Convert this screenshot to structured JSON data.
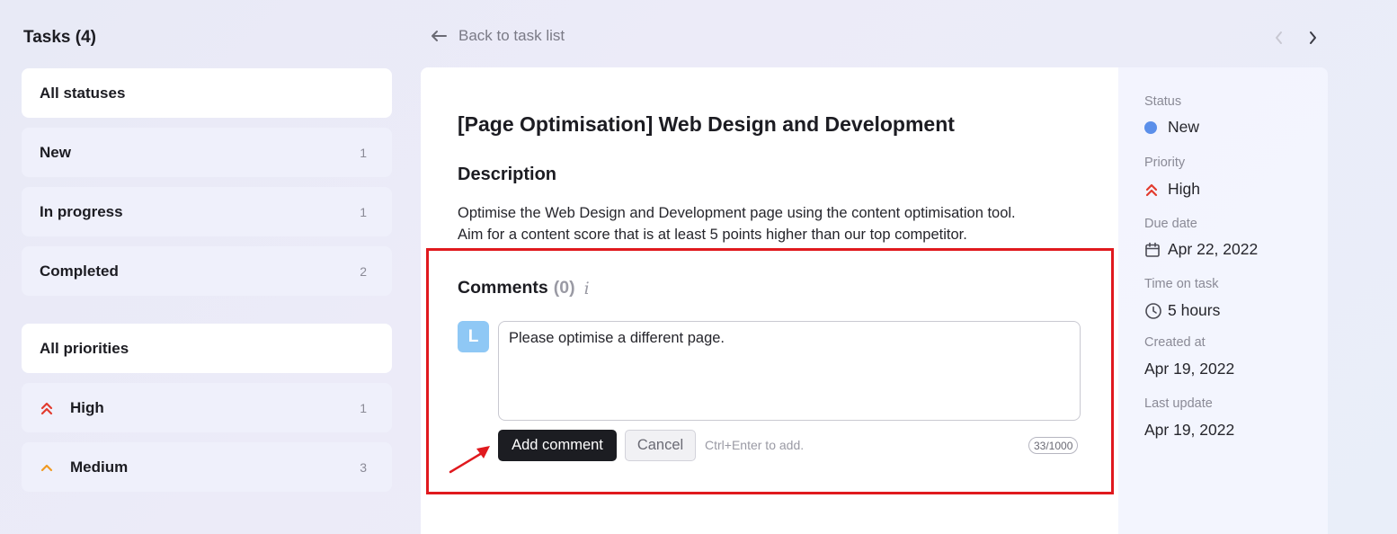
{
  "sidebar": {
    "title": "Tasks (4)",
    "statuses": [
      {
        "label": "All statuses",
        "count": ""
      },
      {
        "label": "New",
        "count": "1"
      },
      {
        "label": "In progress",
        "count": "1"
      },
      {
        "label": "Completed",
        "count": "2"
      }
    ],
    "priorities": [
      {
        "label": "All priorities",
        "count": ""
      },
      {
        "label": "High",
        "count": "1",
        "icon": "double-chevron-up-icon",
        "color": "#e23b2e"
      },
      {
        "label": "Medium",
        "count": "3",
        "icon": "chevron-up-icon",
        "color": "#f09a22"
      }
    ]
  },
  "nav": {
    "back_label": "Back to task list"
  },
  "task": {
    "title": "[Page Optimisation] Web Design and Development",
    "description_heading": "Description",
    "description_lines": [
      "Optimise the Web Design and Development page using the content optimisation tool.",
      "Aim for a content score that is at least 5 points higher than our top competitor."
    ]
  },
  "comments": {
    "title": "Comments",
    "count": "(0)",
    "info_icon": "i",
    "avatar_letter": "L",
    "input_value": "Please optimise a different page.",
    "add_button": "Add comment",
    "cancel_button": "Cancel",
    "hint": "Ctrl+Enter to add.",
    "char_count": "33/1000"
  },
  "details": {
    "status_label": "Status",
    "status_value": "New",
    "priority_label": "Priority",
    "priority_value": "High",
    "due_label": "Due date",
    "due_value": "Apr 22, 2022",
    "time_label": "Time on task",
    "time_value": "5 hours",
    "created_label": "Created at",
    "created_value": "Apr 19, 2022",
    "updated_label": "Last update",
    "updated_value": "Apr 19, 2022"
  },
  "colors": {
    "status_new": "#5b8fea",
    "priority_high": "#e23b2e",
    "priority_medium": "#f09a22",
    "highlight": "#e0191e",
    "primary_button": "#1c1d22",
    "avatar": "#8fc8f5"
  }
}
